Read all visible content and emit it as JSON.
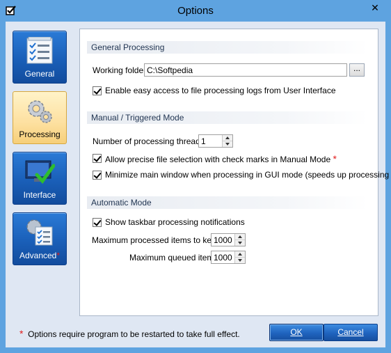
{
  "window": {
    "title": "Options",
    "close_glyph": "✕"
  },
  "sidebar": {
    "items": [
      {
        "label": "General",
        "icon": "checklist-icon",
        "active": false
      },
      {
        "label": "Processing",
        "icon": "gears-icon",
        "active": true
      },
      {
        "label": "Interface",
        "icon": "monitor-check-icon",
        "active": false
      },
      {
        "label": "Advanced",
        "icon": "advanced-settings-icon",
        "active": false,
        "star": "*"
      }
    ]
  },
  "general_processing": {
    "header": "General Processing",
    "working_folder_label": "Working folder:",
    "working_folder_value": "C:\\Softpedia",
    "browse_label": "...",
    "enable_logs_label": "Enable easy access to file processing logs from User Interface",
    "enable_logs_checked": true
  },
  "manual_mode": {
    "header": "Manual / Triggered Mode",
    "threads_label": "Number of processing threads:",
    "threads_value": "1",
    "precise_selection_label": "Allow precise file selection with check marks in Manual Mode",
    "precise_selection_star": "*",
    "precise_selection_checked": true,
    "minimize_label": "Minimize main window when processing in GUI mode (speeds up processing a bit)",
    "minimize_checked": true
  },
  "automatic_mode": {
    "header": "Automatic Mode",
    "taskbar_label": "Show taskbar processing notifications",
    "taskbar_checked": true,
    "max_processed_label": "Maximum processed items to keep:",
    "max_processed_value": "1000",
    "max_queued_label": "Maximum queued items:",
    "max_queued_value": "1000"
  },
  "footer": {
    "star": "*",
    "note": "Options require program to be restarted to take full effect.",
    "ok_label": "OK",
    "cancel_label": "Cancel"
  },
  "colors": {
    "accent": "#5ea3e0",
    "star_red": "#e21b1b",
    "active_tab": "#fde0a0"
  }
}
